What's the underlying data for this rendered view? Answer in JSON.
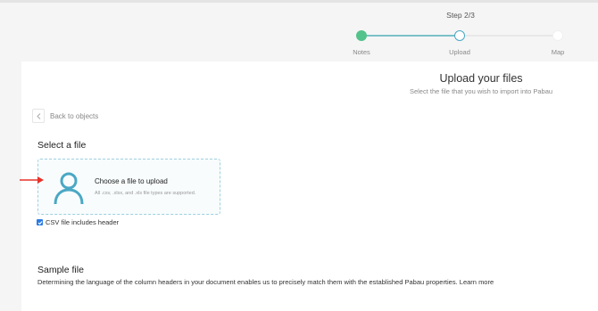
{
  "stepper": {
    "counter": "Step 2/3",
    "steps": [
      {
        "label": "Notes",
        "state": "completed"
      },
      {
        "label": "Upload",
        "state": "active"
      },
      {
        "label": "Map",
        "state": "pending"
      }
    ]
  },
  "header": {
    "title": "Upload your files",
    "subtitle": "Select the file that you wish to import into Pabau"
  },
  "back": {
    "label": "Back to objects",
    "icon": "chevron-left-icon"
  },
  "select_file": {
    "title": "Select a file",
    "dropzone": {
      "icon": "user-icon",
      "title": "Choose a file to upload",
      "hint": "All .csv, .xlsx, and .xls file types are supported."
    },
    "csv_header": {
      "label": "CSV file includes header",
      "checked": true
    }
  },
  "sample_file": {
    "title": "Sample file",
    "description": "Determining the language of the column headers in your document enables us to precisely match them with the established Pabau properties.",
    "learn_more": "Learn more"
  },
  "colors": {
    "completed": "#54c28b",
    "active": "#4aa8c4",
    "icon": "#4aa8c4",
    "annotation_arrow": "#e8322a",
    "checkbox": "#2a7be4"
  }
}
